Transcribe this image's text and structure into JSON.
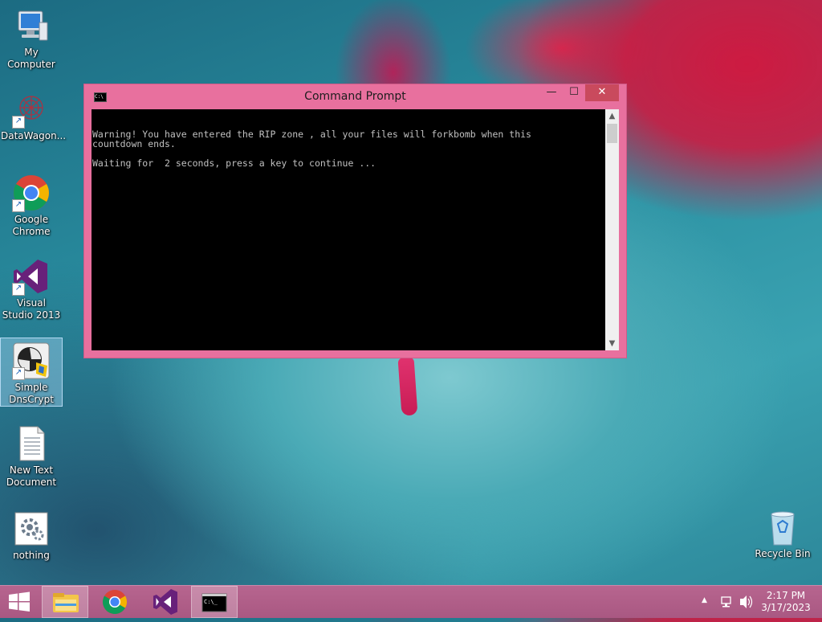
{
  "desktop": {
    "icons": [
      {
        "label": "My Computer"
      },
      {
        "label": "DataWagon..."
      },
      {
        "label": "Google Chrome"
      },
      {
        "label": "Visual Studio 2013"
      },
      {
        "label": "Simple DnsCrypt"
      },
      {
        "label": "New Text Document"
      },
      {
        "label": "nothing"
      },
      {
        "label": "Recycle Bin"
      }
    ],
    "selected_icon": "Simple DnsCrypt"
  },
  "window": {
    "title": "Command Prompt",
    "console_lines": [
      "Warning! You have entered the RIP zone , all your files will forkbomb when this",
      "countdown ends.",
      "",
      "Waiting for  2 seconds, press a key to continue ..."
    ]
  },
  "taskbar": {
    "items": [
      "start-icon",
      "file-explorer-icon",
      "chrome-icon",
      "visual-studio-icon",
      "command-prompt-icon"
    ],
    "active_item": "command-prompt-icon",
    "clock": {
      "time": "2:17 PM",
      "date": "3/17/2023"
    }
  },
  "colors": {
    "window_frame": "#e8709e",
    "taskbar": "#b7658f",
    "close_button": "#c94a5d",
    "console_bg": "#000000",
    "console_text": "#c0c0c0"
  }
}
